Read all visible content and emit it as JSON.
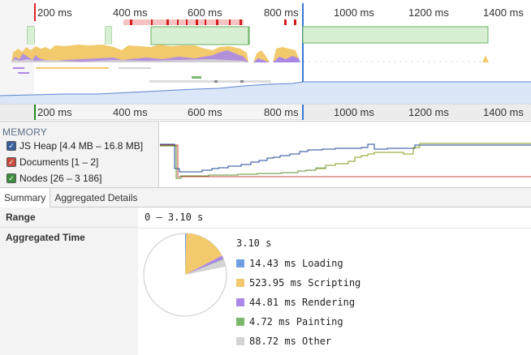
{
  "ruler": {
    "labels": [
      "200 ms",
      "400 ms",
      "600 ms",
      "800 ms",
      "1000 ms",
      "1200 ms",
      "1400 ms"
    ],
    "ticks_ms": [
      200,
      400,
      600,
      800,
      1000,
      1200,
      1400
    ]
  },
  "memory": {
    "title": "MEMORY",
    "counters": [
      {
        "label": "JS Heap [4.4 MB – 16.8 MB]",
        "color": "#3b5e9c",
        "checked": true
      },
      {
        "label": "Documents [1 – 2]",
        "color": "#c84a3e",
        "checked": true
      },
      {
        "label": "Nodes [26 – 3 186]",
        "color": "#3d8f3d",
        "checked": true
      }
    ]
  },
  "tabs": [
    {
      "label": "Summary",
      "active": true
    },
    {
      "label": "Aggregated Details",
      "active": false
    }
  ],
  "summary": {
    "range_label": "Range",
    "range_value": "0 – 3.10 s",
    "aggregated_label": "Aggregated Time",
    "total": "3.10 s",
    "categories": [
      {
        "label": "14.43 ms Loading",
        "value_ms": 14.43,
        "color": "#709fe1"
      },
      {
        "label": "523.95 ms Scripting",
        "value_ms": 523.95,
        "color": "#f2c96c"
      },
      {
        "label": "44.81 ms Rendering",
        "value_ms": 44.81,
        "color": "#ab88e8"
      },
      {
        "label": "4.72 ms Painting",
        "value_ms": 4.72,
        "color": "#7ab86c"
      },
      {
        "label": "88.72 ms Other",
        "value_ms": 88.72,
        "color": "#d4d4d4"
      }
    ],
    "total_ms": 3100
  }
}
